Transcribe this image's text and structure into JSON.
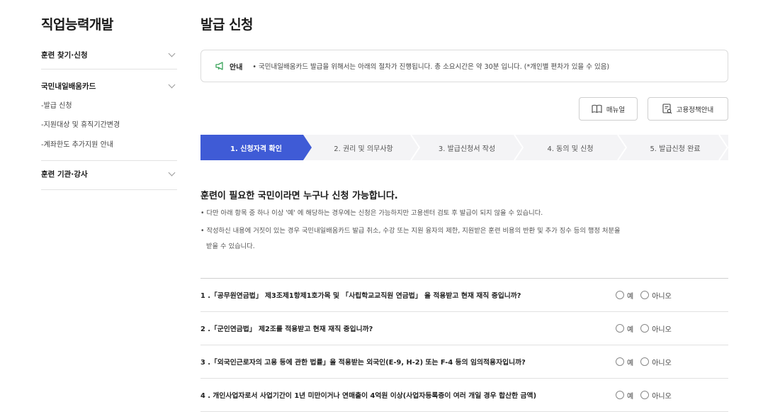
{
  "sidebar": {
    "title": "직업능력개발",
    "sections": [
      {
        "label": "훈련 찾기·신청",
        "subitems": []
      },
      {
        "label": "국민내일배움카드",
        "subitems": [
          "-발급 신청",
          "-지원대상 및 휴직기간변경",
          "-계좌한도 추가지원 안내"
        ]
      },
      {
        "label": "훈련 기관·강사",
        "subitems": []
      }
    ]
  },
  "main": {
    "title": "발급 신청",
    "notice": {
      "label": "안내",
      "text": "• 국민내일배움카드 발급을 위해서는 아래의 절차가 진행됩니다. 총 소요시간은 약 30분 입니다. (*개인별 편차가 있을 수 있음)"
    },
    "buttons": {
      "manual": "매뉴얼",
      "policy": "고용정책안내"
    },
    "steps": [
      "1. 신청자격 확인",
      "2. 권리 및 의무사항",
      "3. 발급신청서 작성",
      "4. 동의 및 신청",
      "5. 발급신청 완료"
    ],
    "headline": "훈련이 필요한 국민이라면 누구나 신청 가능합니다.",
    "bullets": [
      "• 다만 아래 항목 중 하나 이상 '예' 에 해당하는 경우에는 신청은 가능하지만 고용센터 검토 후 발급이 되지 않을 수 있습니다.",
      "• 작성하신 내용에 거짓이 있는 경우 국민내일배움카드 발급 취소, 수강 또는 지원 융자의 제한, 지원받은 훈련 비용의 반환 및 추가 징수 등의 행정 처분을",
      "받을 수 있습니다."
    ],
    "questions": [
      "1 .「공무원연금법」 제3조제1항제1호가목 및 「사립학교교직원 연금법」 을 적용받고 현재 재직 중입니까?",
      "2 .「군인연금법」 제2조를 적용받고 현재 재직 중입니까?",
      "3 .「외국인근로자의 고용 등에 관한 법률」을 적용받는 외국인(E-9, H-2) 또는 F-4 등의 임의적용자입니까?",
      "4 . 개인사업자로서 사업기간이 1년 미만이거나 연매출이 4억원 이상(사업자등록증이 여러 개일 경우 합산한 금액)"
    ],
    "options": {
      "yes": "예",
      "no": "아니오"
    }
  },
  "colors": {
    "accent": "#3f5bd6",
    "step_bg": "#f4f4f6"
  }
}
